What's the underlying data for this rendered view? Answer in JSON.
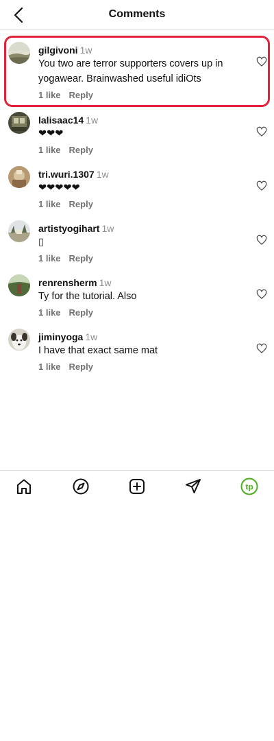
{
  "header": {
    "title": "Comments"
  },
  "comments": [
    {
      "username": "gilgivoni",
      "time": "1w",
      "text": "You two are terror supporters covers up in yogawear. Brainwashed useful idiOts",
      "likes": "1 like",
      "reply": "Reply"
    },
    {
      "username": "lalisaac14",
      "time": "1w",
      "text": "❤❤❤",
      "likes": "1 like",
      "reply": "Reply"
    },
    {
      "username": "tri.wuri.1307",
      "time": "1w",
      "text": "❤❤❤❤❤",
      "likes": "1 like",
      "reply": "Reply"
    },
    {
      "username": "artistyogihart",
      "time": "1w",
      "text": "▯",
      "likes": "1 like",
      "reply": "Reply"
    },
    {
      "username": "renrensherm",
      "time": "1w",
      "text": "Ty for the tutorial. Also",
      "likes": "1 like",
      "reply": "Reply"
    },
    {
      "username": "jiminyoga",
      "time": "1w",
      "text": "I have that exact same mat",
      "likes": "1 like",
      "reply": "Reply"
    }
  ],
  "highlight_color": "#e0223a",
  "nav": {
    "items": [
      "home-icon",
      "explore-icon",
      "create-icon",
      "direct-icon",
      "profile-avatar"
    ],
    "profile_initials": "tp",
    "profile_color": "#4caf1f"
  }
}
